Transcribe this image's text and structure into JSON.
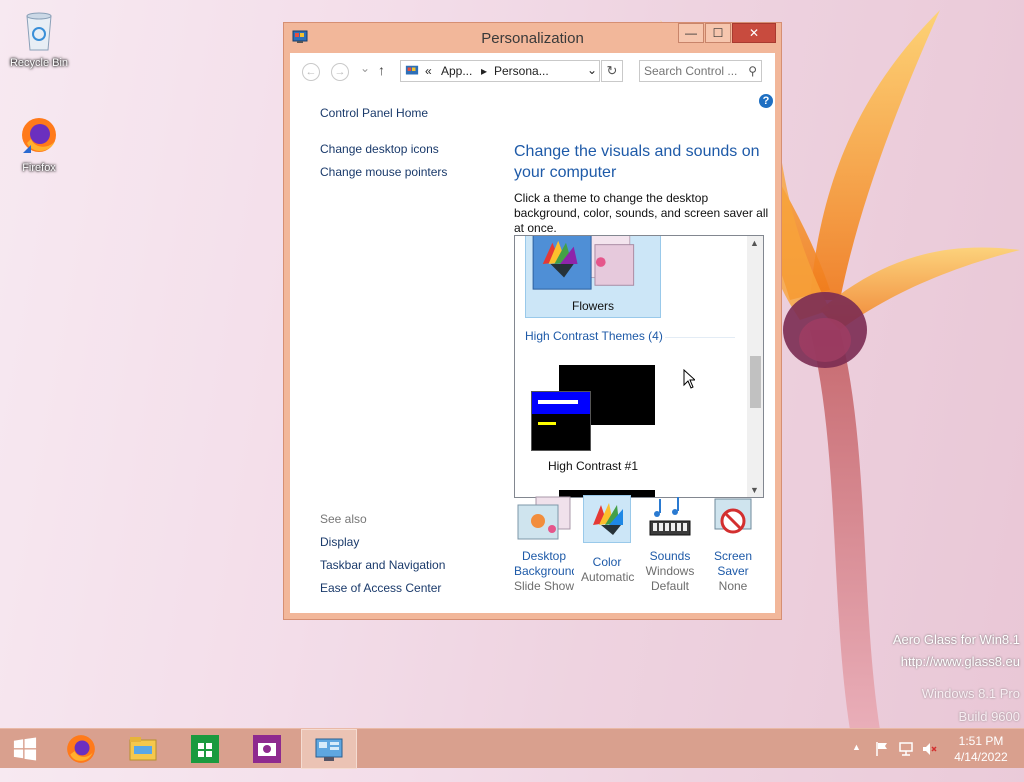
{
  "desktop": {
    "icons": [
      {
        "label": "Recycle Bin"
      },
      {
        "label": "Firefox"
      }
    ],
    "watermark": {
      "line1": "Aero Glass for Win8.1",
      "line2": "http://www.glass8.eu",
      "line3": "Windows 8.1 Pro",
      "line4": "Build 9600"
    }
  },
  "window": {
    "title": "Personalization",
    "buttons": {
      "minimize": "—",
      "maximize": "☐",
      "close": "✕"
    },
    "nav": {
      "back": "←",
      "forward": "→",
      "up": "↑",
      "breadcrumb": [
        "«",
        "App...",
        "▸",
        "Persona..."
      ],
      "dropdown": "⌄",
      "refresh": "↻",
      "search_placeholder": "Search Control ...",
      "search_icon": "⚲"
    },
    "help": "?",
    "sidebar": {
      "home": "Control Panel Home",
      "links": [
        "Change desktop icons",
        "Change mouse pointers"
      ],
      "see_also_label": "See also",
      "see_also": [
        "Display",
        "Taskbar and Navigation",
        "Ease of Access Center"
      ]
    },
    "main": {
      "heading": "Change the visuals and sounds on your computer",
      "description": "Click a theme to change the desktop background, color, sounds, and screen saver all at once.",
      "selected_theme": "Flowers",
      "group_header": "High Contrast Themes (4)",
      "theme2": "High Contrast #1"
    },
    "bottom": [
      {
        "label": "Desktop Background",
        "sub": "Slide Show"
      },
      {
        "label": "Color",
        "sub": "Automatic"
      },
      {
        "label": "Sounds",
        "sub": "Windows Default"
      },
      {
        "label": "Screen Saver",
        "sub": "None"
      }
    ]
  },
  "taskbar": {
    "clock_time": "1:51 PM",
    "clock_date": "4/14/2022",
    "tray_arrow": "▲"
  },
  "colors": {
    "accent": "#1e5aa8",
    "titlebar": "#f2b79a",
    "taskbar": "#d9a08e"
  }
}
